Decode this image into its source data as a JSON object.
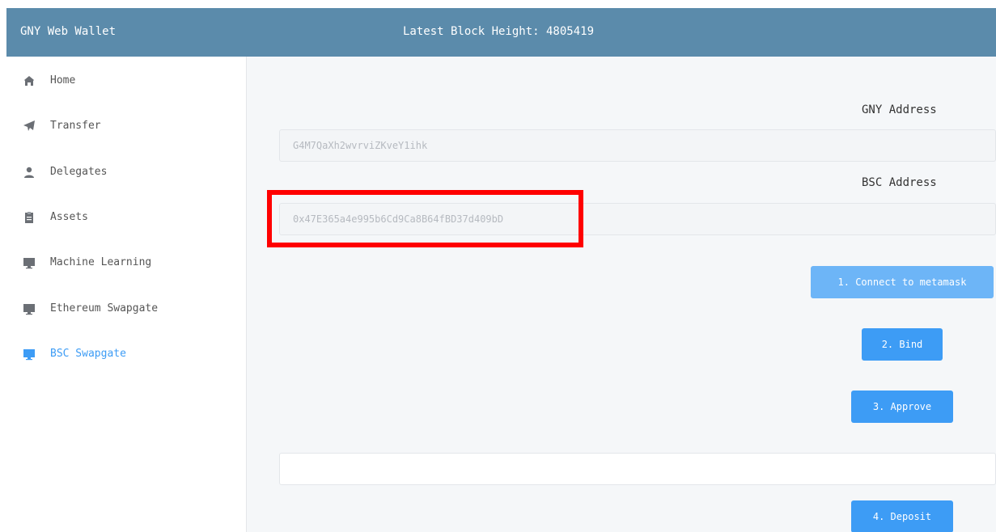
{
  "header": {
    "app_title": "GNY Web Wallet",
    "block_height_label": "Latest Block Height: 4805419"
  },
  "sidebar": {
    "items": [
      {
        "label": "Home",
        "icon": "home-icon"
      },
      {
        "label": "Transfer",
        "icon": "send-icon"
      },
      {
        "label": "Delegates",
        "icon": "user-icon"
      },
      {
        "label": "Assets",
        "icon": "clipboard-icon"
      },
      {
        "label": "Machine Learning",
        "icon": "monitor-icon"
      },
      {
        "label": "Ethereum Swapgate",
        "icon": "monitor-icon"
      },
      {
        "label": "BSC Swapgate",
        "icon": "monitor-icon",
        "active": true
      }
    ]
  },
  "main": {
    "gny_address_label": "GNY Address",
    "gny_address_value": "G4M7QaXh2wvrviZKveY1ihk",
    "bsc_address_label": "BSC Address",
    "bsc_address_value": "0x47E365a4e995b6Cd9Ca8B64fBD37d409bD",
    "amount_value": "",
    "connect_button": "1. Connect to metamask",
    "bind_button": "2. Bind",
    "approve_button": "3. Approve",
    "deposit_button": "4. Deposit"
  },
  "colors": {
    "header_bg": "#5b8bab",
    "accent": "#3d9cf5",
    "highlight": "#ff0000"
  }
}
